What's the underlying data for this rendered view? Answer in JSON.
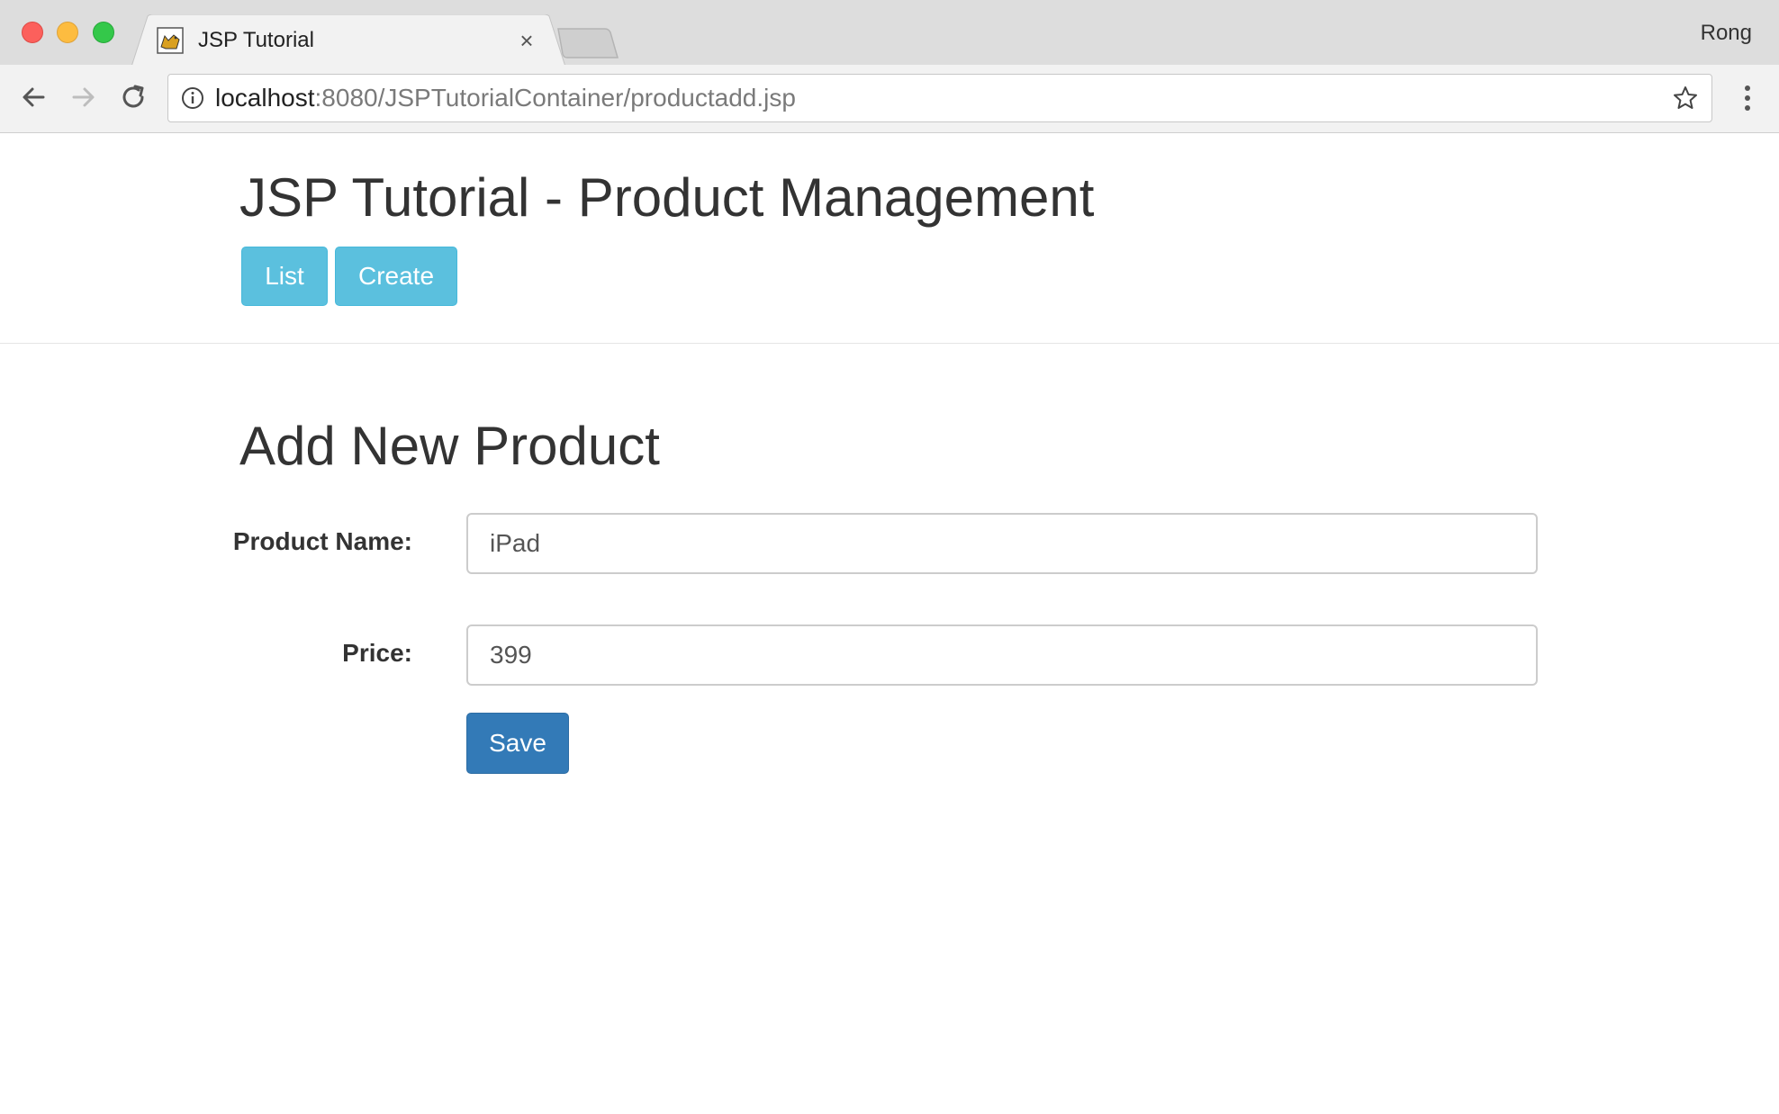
{
  "browser": {
    "tab": {
      "title": "JSP Tutorial",
      "close_glyph": "×",
      "favicon": "tomcat-icon"
    },
    "profile_name": "Rong",
    "address_bar": {
      "host": "localhost",
      "path": ":8080/JSPTutorialContainer/productadd.jsp"
    },
    "icons": {
      "back": "back-arrow-icon",
      "forward": "forward-arrow-icon",
      "reload": "reload-icon",
      "info": "info-icon",
      "bookmark": "star-icon",
      "menu": "kebab-menu-icon"
    }
  },
  "page": {
    "app_title": "JSP Tutorial - Product Management",
    "nav": {
      "list_label": "List",
      "create_label": "Create"
    },
    "section_title": "Add New Product",
    "form": {
      "product_name_label": "Product Name:",
      "product_name_value": "iPad",
      "price_label": "Price:",
      "price_value": "399",
      "save_label": "Save"
    }
  },
  "colors": {
    "info_button": "#5bc0de",
    "primary_button": "#337ab7",
    "heading_text": "#333333"
  }
}
